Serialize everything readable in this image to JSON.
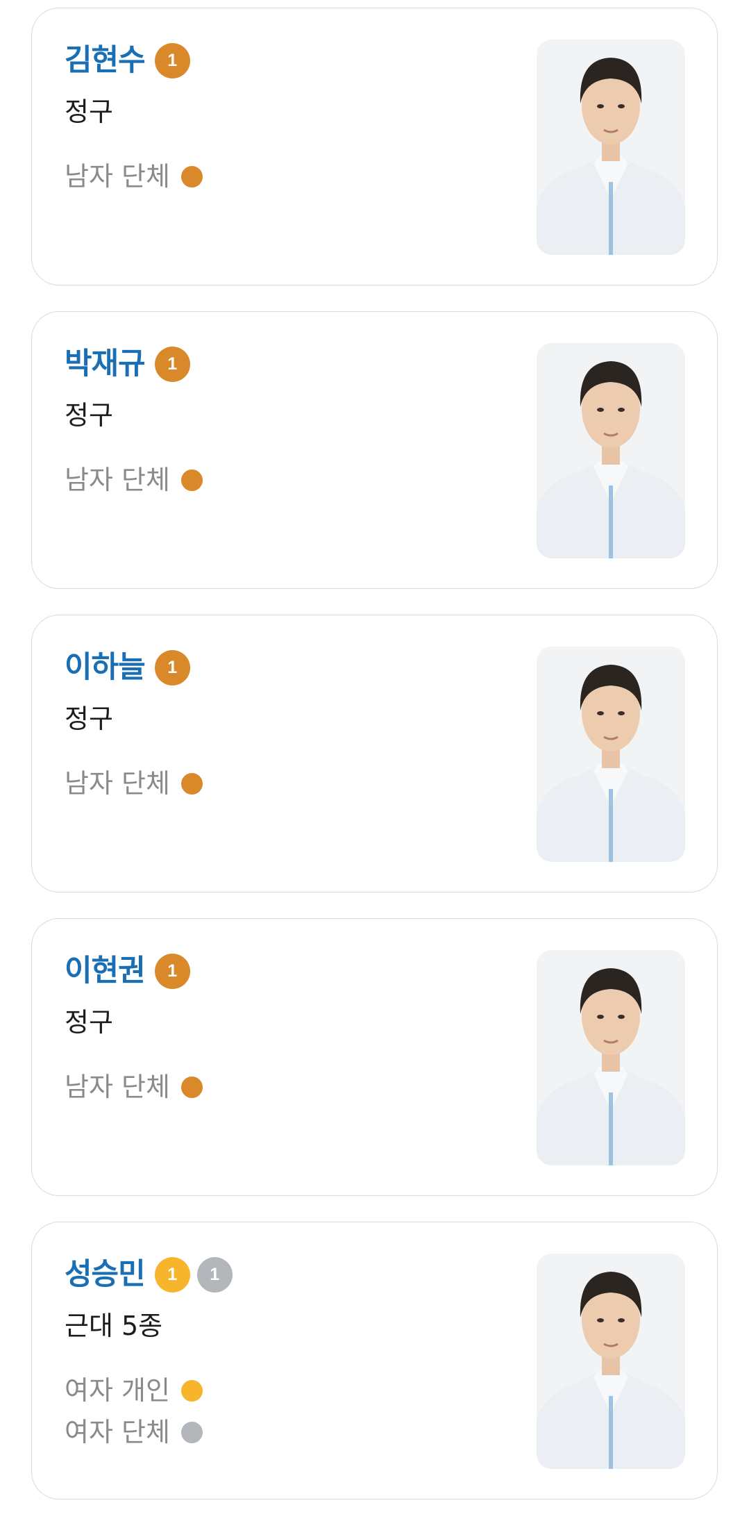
{
  "colors": {
    "name": "#1a6fb4",
    "gold_team": "#d9892a",
    "gold_individual": "#f6b52a",
    "silver": "#b3b6ba"
  },
  "athletes": [
    {
      "name": "김현수",
      "sport": "정구",
      "badges": [
        {
          "count": "1",
          "color": "#d9892a"
        }
      ],
      "events": [
        {
          "label": "남자 단체",
          "color": "#d9892a"
        }
      ],
      "photo": "athlete-portrait"
    },
    {
      "name": "박재규",
      "sport": "정구",
      "badges": [
        {
          "count": "1",
          "color": "#d9892a"
        }
      ],
      "events": [
        {
          "label": "남자 단체",
          "color": "#d9892a"
        }
      ],
      "photo": "athlete-portrait"
    },
    {
      "name": "이하늘",
      "sport": "정구",
      "badges": [
        {
          "count": "1",
          "color": "#d9892a"
        }
      ],
      "events": [
        {
          "label": "남자 단체",
          "color": "#d9892a"
        }
      ],
      "photo": "athlete-portrait"
    },
    {
      "name": "이현권",
      "sport": "정구",
      "badges": [
        {
          "count": "1",
          "color": "#d9892a"
        }
      ],
      "events": [
        {
          "label": "남자 단체",
          "color": "#d9892a"
        }
      ],
      "photo": "athlete-portrait"
    },
    {
      "name": "성승민",
      "sport": "근대 5종",
      "badges": [
        {
          "count": "1",
          "color": "#f6b52a"
        },
        {
          "count": "1",
          "color": "#b3b6ba"
        }
      ],
      "events": [
        {
          "label": "여자 개인",
          "color": "#f6b52a"
        },
        {
          "label": "여자 단체",
          "color": "#b3b6ba"
        }
      ],
      "photo": "athlete-portrait"
    }
  ]
}
